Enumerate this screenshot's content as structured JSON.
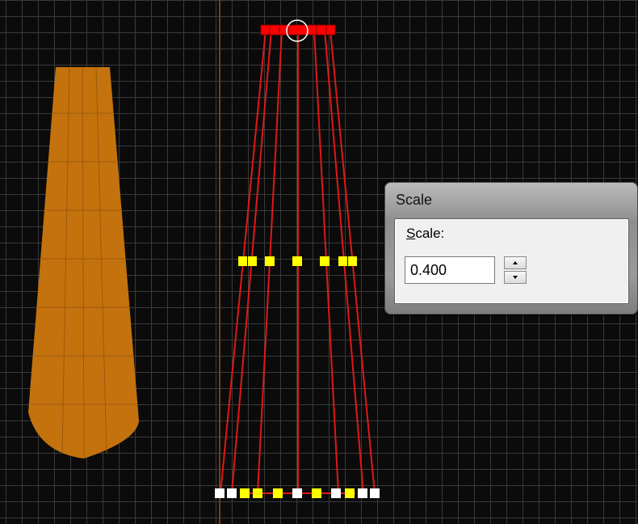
{
  "scale_dialog": {
    "title": "Scale",
    "field_label_accel": "S",
    "field_label_rest": "cale:",
    "value": "0.400"
  },
  "colors": {
    "viewport_bg": "#0b0b0b",
    "grid_line": "#3a3a3a",
    "axis_line": "#7a3c14",
    "cone_fill": "#c4720e",
    "selected_vertex": "#ff0000",
    "soft_selection": "#ffff00",
    "unselected_vertex": "#ffffff",
    "edge": "#e01818"
  },
  "icons": {
    "spin_up": "triangle-up",
    "spin_down": "triangle-down",
    "cursor": "circle-cursor"
  }
}
